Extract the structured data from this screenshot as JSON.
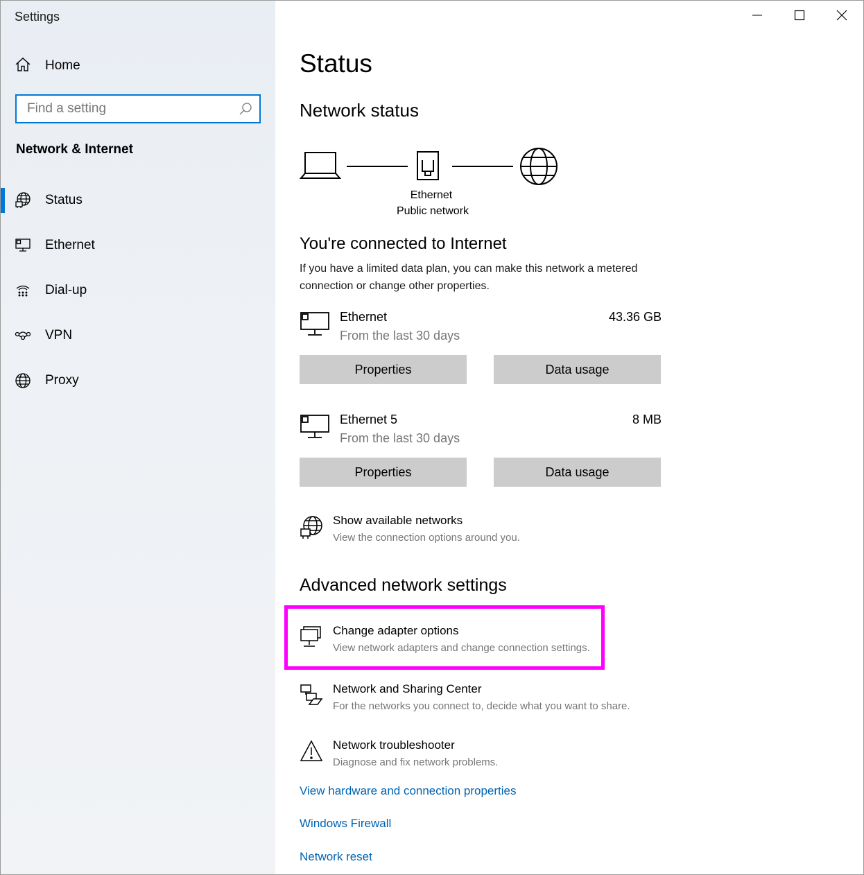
{
  "window": {
    "title": "Settings"
  },
  "sidebar": {
    "home_label": "Home",
    "search_placeholder": "Find a setting",
    "section_title": "Network & Internet",
    "items": [
      {
        "label": "Status",
        "icon": "globe-status-icon",
        "active": true
      },
      {
        "label": "Ethernet",
        "icon": "ethernet-icon",
        "active": false
      },
      {
        "label": "Dial-up",
        "icon": "dialup-icon",
        "active": false
      },
      {
        "label": "VPN",
        "icon": "vpn-icon",
        "active": false
      },
      {
        "label": "Proxy",
        "icon": "globe-icon",
        "active": false
      }
    ]
  },
  "main": {
    "title": "Status",
    "network_status_heading": "Network status",
    "diagram": {
      "adapter_label": "Ethernet",
      "network_label": "Public network"
    },
    "connected_heading": "You're connected to Internet",
    "connected_text": "If you have a limited data plan, you can make this network a metered connection or change other properties.",
    "connections": [
      {
        "name": "Ethernet",
        "sub": "From the last 30 days",
        "amount": "43.36 GB",
        "properties_label": "Properties",
        "data_usage_label": "Data usage"
      },
      {
        "name": "Ethernet 5",
        "sub": "From the last 30 days",
        "amount": "8 MB",
        "properties_label": "Properties",
        "data_usage_label": "Data usage"
      }
    ],
    "show_networks": {
      "title": "Show available networks",
      "desc": "View the connection options around you."
    },
    "advanced_heading": "Advanced network settings",
    "advanced_items": [
      {
        "title": "Change adapter options",
        "desc": "View network adapters and change connection settings."
      },
      {
        "title": "Network and Sharing Center",
        "desc": "For the networks you connect to, decide what you want to share."
      },
      {
        "title": "Network troubleshooter",
        "desc": "Diagnose and fix network problems."
      }
    ],
    "links": [
      "View hardware and connection properties",
      "Windows Firewall",
      "Network reset"
    ]
  },
  "colors": {
    "accent": "#0078d7",
    "link": "#0063b1",
    "highlight": "#ff00ff",
    "button": "#cccccc"
  }
}
